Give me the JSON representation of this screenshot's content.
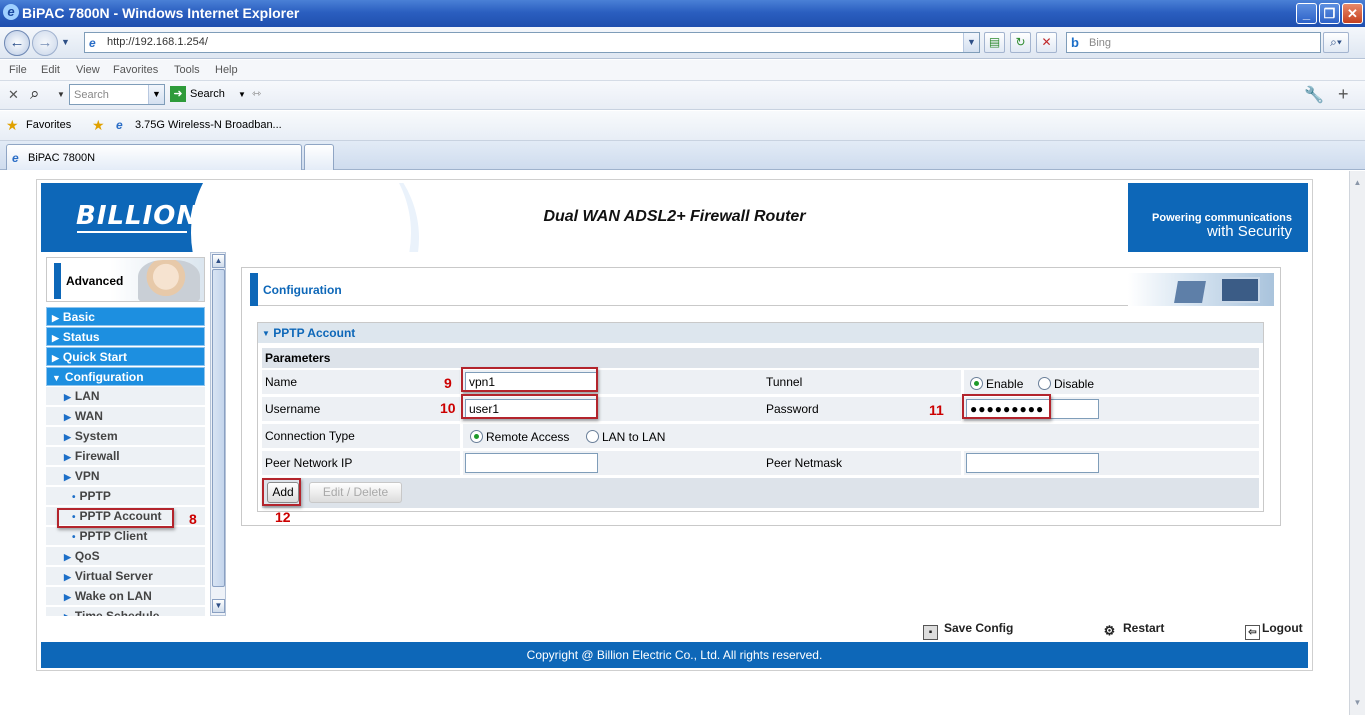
{
  "window": {
    "title": "BiPAC 7800N - Windows Internet Explorer"
  },
  "navbar": {
    "url": "http://192.168.1.254/",
    "bing_placeholder": "Bing"
  },
  "menubar": [
    "File",
    "Edit",
    "View",
    "Favorites",
    "Tools",
    "Help"
  ],
  "toolbar2": {
    "search_placeholder": "Search",
    "search_button": "Search"
  },
  "favorites": {
    "label": "Favorites",
    "link": "3.75G Wireless-N Broadban..."
  },
  "tabs": {
    "active": "BiPAC 7800N"
  },
  "banner": {
    "brand": "BILLION",
    "title": "Dual WAN ADSL2+ Firewall Router",
    "slogan_line1": "Powering communications",
    "slogan_line2": "with Security"
  },
  "sidebar": {
    "section": "Advanced",
    "items": [
      {
        "label": "Basic",
        "level": "top"
      },
      {
        "label": "Status",
        "level": "top"
      },
      {
        "label": "Quick Start",
        "level": "top"
      },
      {
        "label": "Configuration",
        "level": "top-open"
      },
      {
        "label": "LAN",
        "level": "sub"
      },
      {
        "label": "WAN",
        "level": "sub"
      },
      {
        "label": "System",
        "level": "sub"
      },
      {
        "label": "Firewall",
        "level": "sub"
      },
      {
        "label": "VPN",
        "level": "sub"
      },
      {
        "label": "PPTP",
        "level": "sub2"
      },
      {
        "label": "PPTP Account",
        "level": "sub2"
      },
      {
        "label": "PPTP Client",
        "level": "sub2"
      },
      {
        "label": "QoS",
        "level": "sub"
      },
      {
        "label": "Virtual Server",
        "level": "sub"
      },
      {
        "label": "Wake on LAN",
        "level": "sub"
      },
      {
        "label": "Time Schedule",
        "level": "sub"
      }
    ]
  },
  "config": {
    "heading": "Configuration",
    "section_title": "PPTP Account",
    "parameters_label": "Parameters",
    "name_label": "Name",
    "name_value": "vpn1",
    "username_label": "Username",
    "username_value": "user1",
    "connection_type_label": "Connection Type",
    "conn_remote": "Remote Access",
    "conn_lan": "LAN to LAN",
    "peer_ip_label": "Peer Network IP",
    "peer_ip_value": "",
    "tunnel_label": "Tunnel",
    "tunnel_enable": "Enable",
    "tunnel_disable": "Disable",
    "password_label": "Password",
    "password_value": "●●●●●●●●●",
    "peer_netmask_label": "Peer Netmask",
    "peer_netmask_value": "",
    "add_button": "Add",
    "edit_delete_button": "Edit / Delete"
  },
  "annotations": {
    "n8": "8",
    "n9": "9",
    "n10": "10",
    "n11": "11",
    "n12": "12"
  },
  "footer": {
    "save": "Save Config",
    "restart": "Restart",
    "logout": "Logout",
    "copyright": "Copyright @ Billion Electric Co., Ltd. All rights reserved."
  },
  "colors": {
    "accent": "#0d67b8",
    "menu_blue": "#1d8fe0",
    "annotation_red": "#cc0000"
  }
}
